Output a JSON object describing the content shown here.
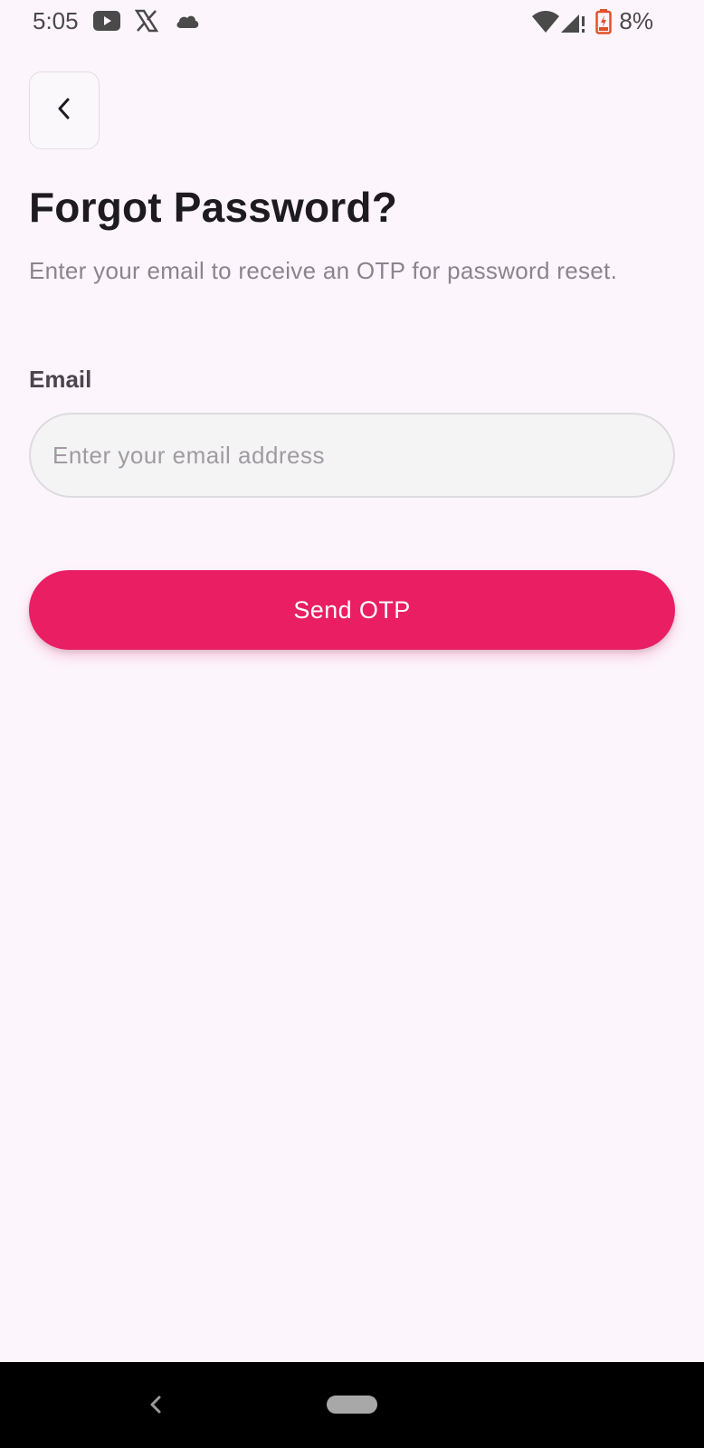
{
  "status_bar": {
    "time": "5:05",
    "battery": "8%",
    "icons": [
      "youtube-icon",
      "x-icon",
      "cloud-icon",
      "wifi-icon",
      "cell-signal-icon",
      "battery-charging-icon"
    ]
  },
  "header": {
    "back_icon": "chevron-left-icon",
    "title": "Forgot Password?",
    "subtitle": "Enter your email to receive an OTP for password reset."
  },
  "form": {
    "email_label": "Email",
    "email_value": "",
    "email_placeholder": "Enter your email address",
    "submit_label": "Send OTP"
  },
  "nav_bar": {
    "icons": [
      "nav-back-icon",
      "nav-home-pill"
    ]
  },
  "colors": {
    "background": "#fcf5fc",
    "accent": "#e91e63",
    "title": "#1d1b20",
    "subtitle": "#8a858c",
    "field_bg": "#f4f4f4"
  }
}
